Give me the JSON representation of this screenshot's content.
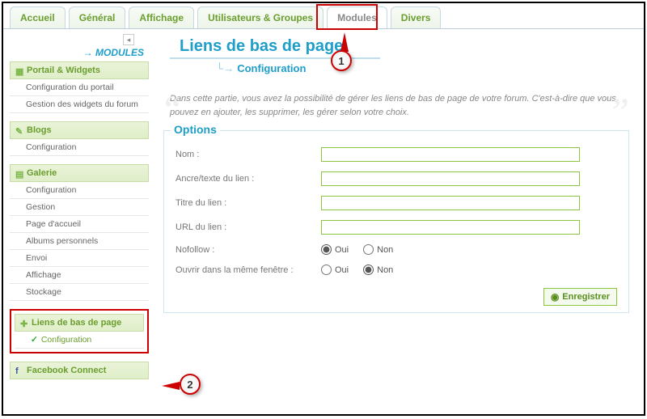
{
  "tabs": {
    "accueil": "Accueil",
    "general": "Général",
    "affichage": "Affichage",
    "users": "Utilisateurs & Groupes",
    "modules": "Modules",
    "divers": "Divers"
  },
  "sidebar": {
    "header": "MODULES",
    "portail": {
      "title": "Portail & Widgets",
      "items": [
        "Configuration du portail",
        "Gestion des widgets du forum"
      ]
    },
    "blogs": {
      "title": "Blogs",
      "items": [
        "Configuration"
      ]
    },
    "galerie": {
      "title": "Galerie",
      "items": [
        "Configuration",
        "Gestion",
        "Page d'accueil",
        "Albums personnels",
        "Envoi",
        "Affichage",
        "Stockage"
      ]
    },
    "liens": {
      "title": "Liens de bas de page",
      "items": [
        "Configuration"
      ]
    },
    "fb": {
      "title": "Facebook Connect"
    }
  },
  "page": {
    "title": "Liens de bas de page",
    "subtitle": "Configuration",
    "desc": "Dans cette partie, vous avez la possibilité de gérer les liens de bas de page de votre forum. C'est-à-dire que vous pouvez en ajouter, les supprimer, les gérer selon votre choix."
  },
  "options": {
    "title": "Options",
    "nom_label": "Nom :",
    "ancre_label": "Ancre/texte du lien :",
    "titre_label": "Titre du lien :",
    "url_label": "URL du lien :",
    "nofollow_label": "Nofollow :",
    "samewin_label": "Ouvrir dans la même fenêtre :",
    "oui": "Oui",
    "non": "Non",
    "save": "Enregistrer",
    "nom_val": "",
    "ancre_val": "",
    "titre_val": "",
    "url_val": "",
    "nofollow_val": "Oui",
    "samewin_val": "Non"
  },
  "callouts": {
    "c1": "1",
    "c2": "2"
  }
}
